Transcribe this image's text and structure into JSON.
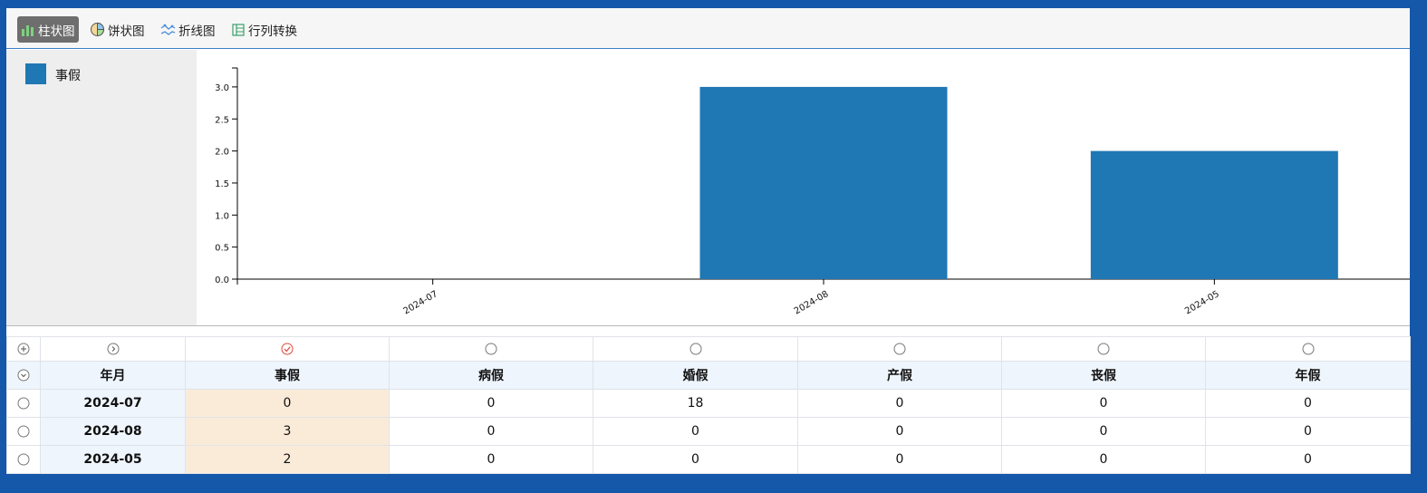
{
  "toolbar": {
    "bar": "柱状图",
    "pie": "饼状图",
    "line": "折线图",
    "transpose": "行列转换"
  },
  "legend": {
    "label": "事假",
    "color": "#1f77b4"
  },
  "chart_data": {
    "type": "bar",
    "categories": [
      "2024-07",
      "2024-08",
      "2024-05"
    ],
    "series": [
      {
        "name": "事假",
        "values": [
          0,
          3,
          2
        ],
        "color": "#1f77b4"
      }
    ],
    "ylim": [
      0,
      3.3
    ],
    "yticks": [
      "0.0",
      "0.5",
      "1.0",
      "1.5",
      "2.0",
      "2.5",
      "3.0"
    ],
    "grid": false,
    "legend_position": "left"
  },
  "table": {
    "columns": [
      "年月",
      "事假",
      "病假",
      "婚假",
      "产假",
      "丧假",
      "年假"
    ],
    "rows": [
      [
        "2024-07",
        "0",
        "0",
        "18",
        "0",
        "0",
        "0"
      ],
      [
        "2024-08",
        "3",
        "0",
        "0",
        "0",
        "0",
        "0"
      ],
      [
        "2024-05",
        "2",
        "0",
        "0",
        "0",
        "0",
        "0"
      ]
    ],
    "selected_column": 1
  },
  "colors": {
    "accent": "#1f77b4",
    "frame": "#1557a8",
    "highlight": "#faebd9",
    "check": "#e0463c"
  }
}
